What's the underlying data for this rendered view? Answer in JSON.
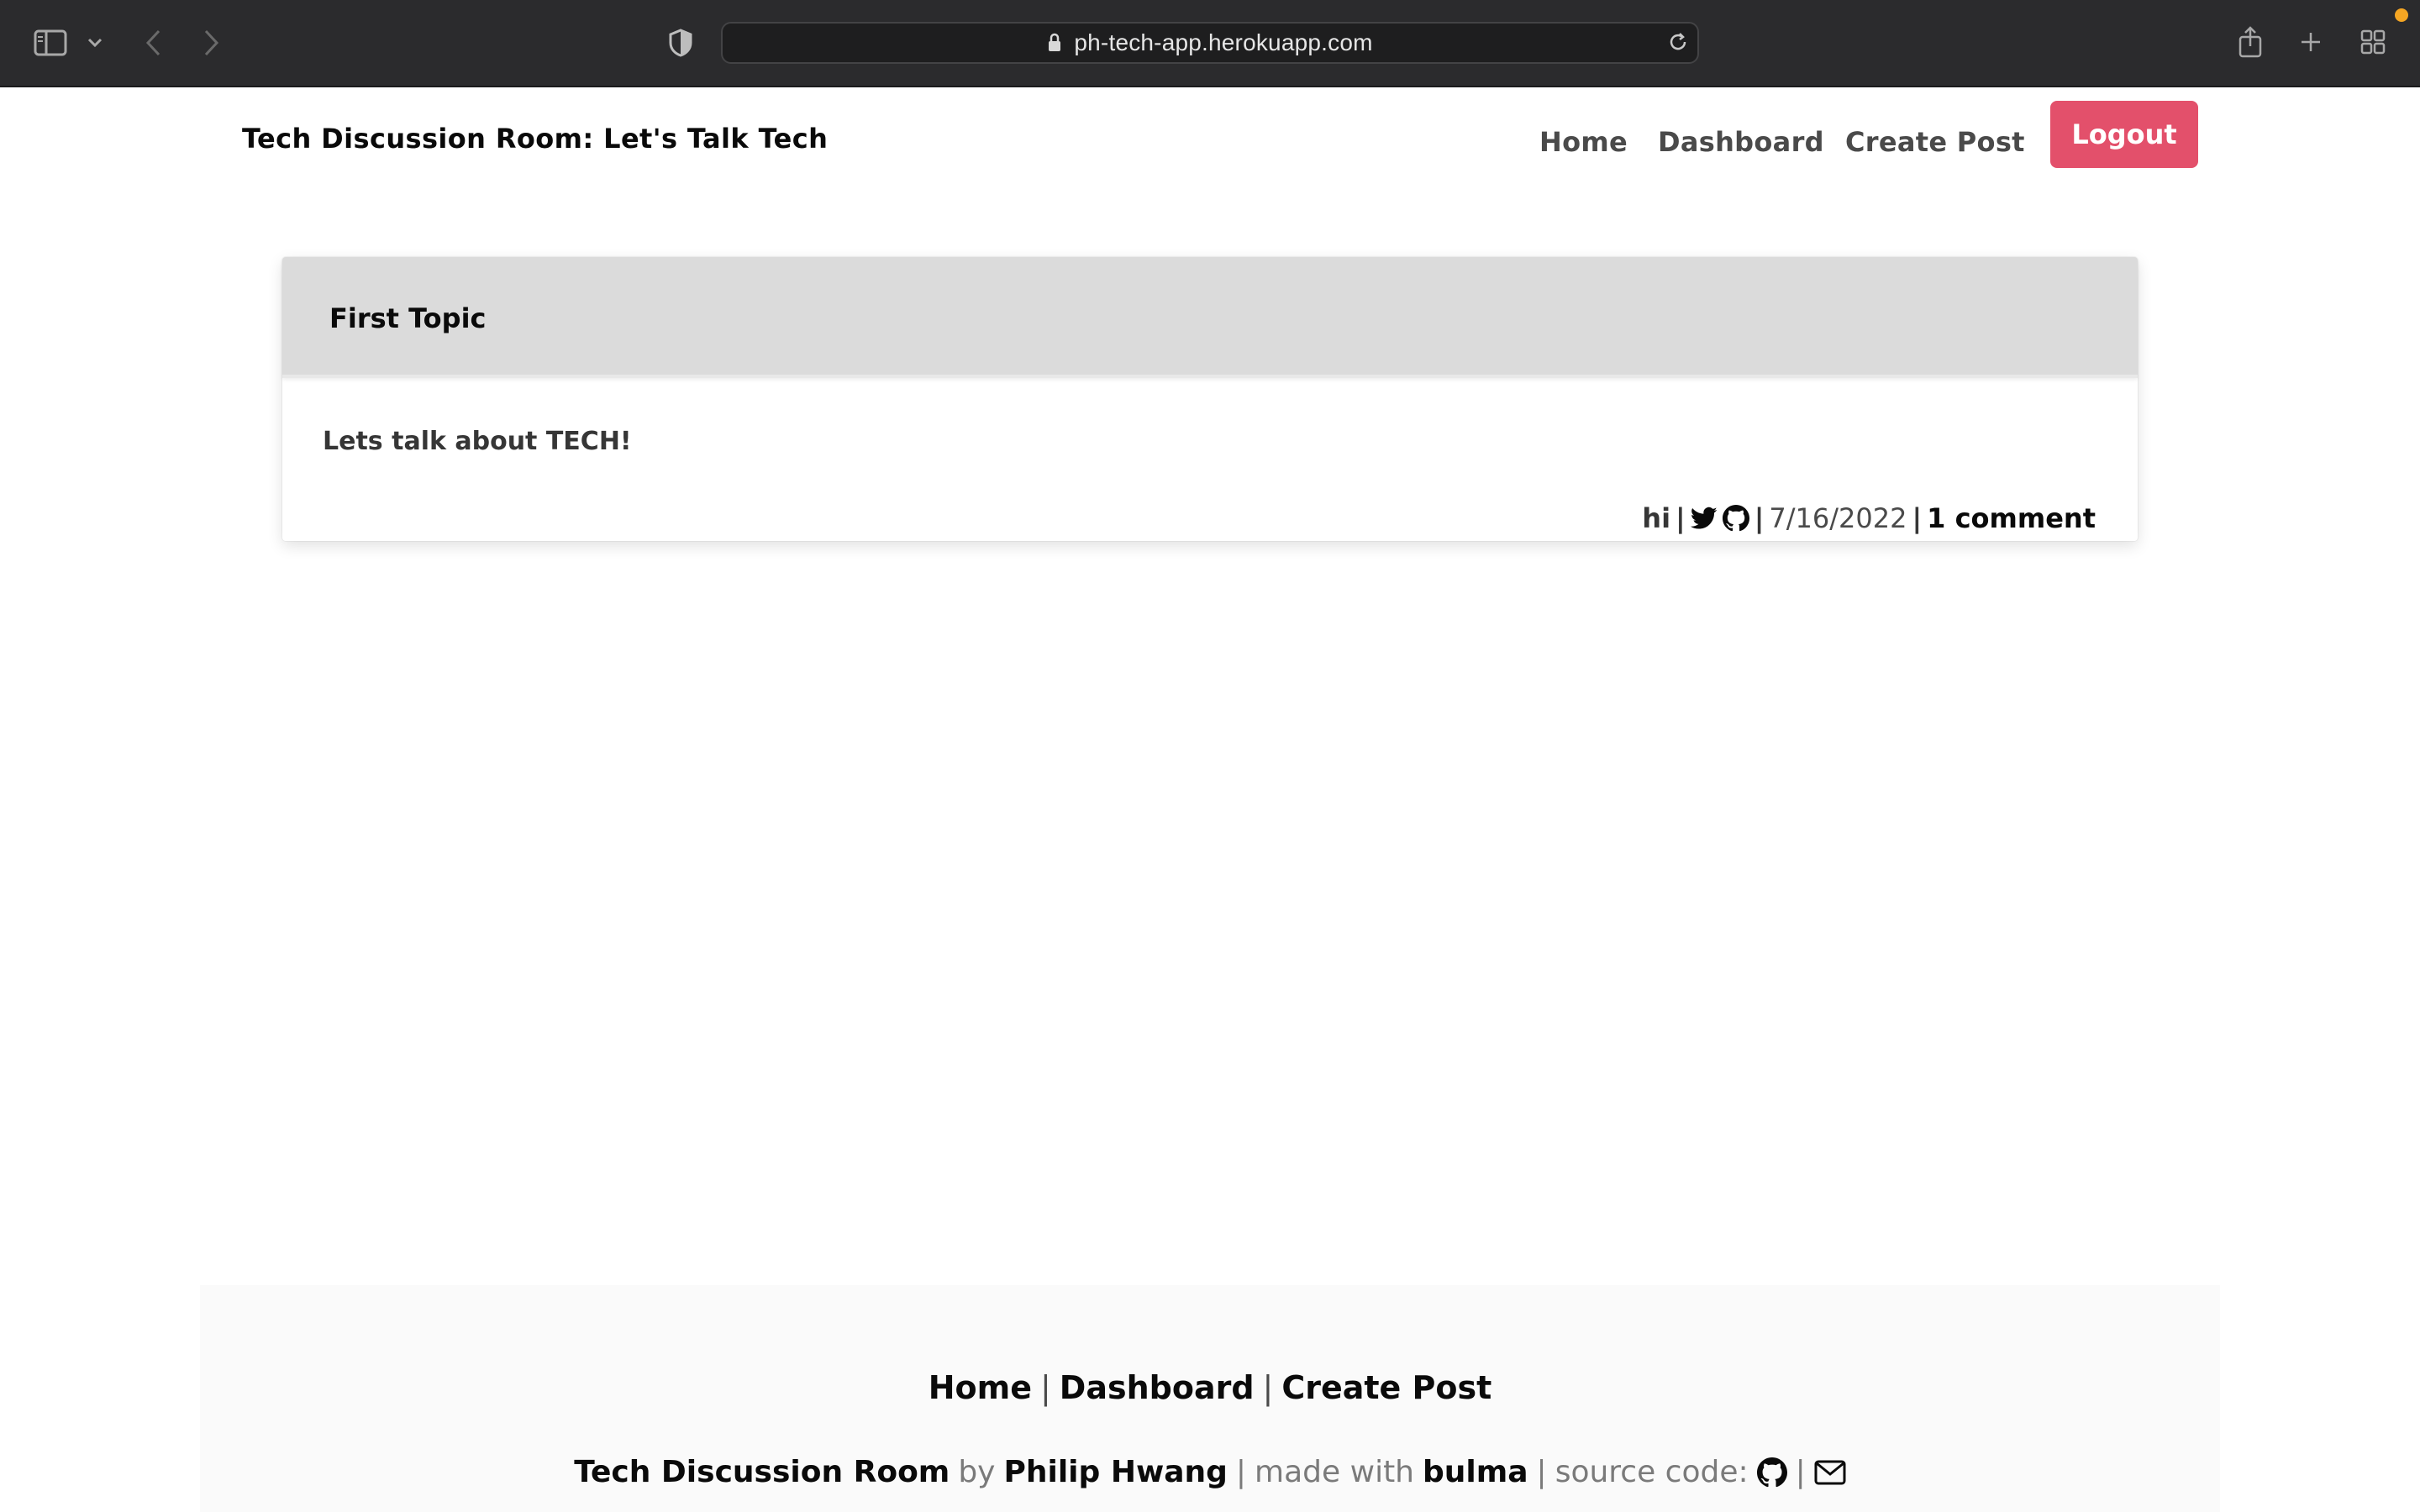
{
  "browser": {
    "url": "ph-tech-app.herokuapp.com",
    "icons": [
      "sidebar-icon",
      "chevron-down-icon",
      "back-icon",
      "forward-icon",
      "shield-icon",
      "lock-icon",
      "reload-icon",
      "share-icon",
      "new-tab-icon",
      "tab-overview-icon"
    ]
  },
  "navbar": {
    "brand": "Tech Discussion Room: Let's Talk Tech",
    "links": [
      "Home",
      "Dashboard",
      "Create Post"
    ],
    "logout_label": "Logout",
    "logout_color": "#e3506b"
  },
  "post": {
    "title": "First Topic",
    "body": "Lets talk about TECH!",
    "author": "hi",
    "separator": "|",
    "date": "7/16/2022",
    "comments": "1 comment",
    "icons": [
      "twitter-icon",
      "github-icon"
    ]
  },
  "footer": {
    "links": [
      "Home",
      "Dashboard",
      "Create Post"
    ],
    "separator": "|",
    "site_name": "Tech Discussion Room",
    "by": "by",
    "author": "Philip Hwang",
    "made_with": "made with",
    "framework": "bulma",
    "source_code": "source code:",
    "icons": [
      "github-icon",
      "envelope-icon"
    ]
  }
}
